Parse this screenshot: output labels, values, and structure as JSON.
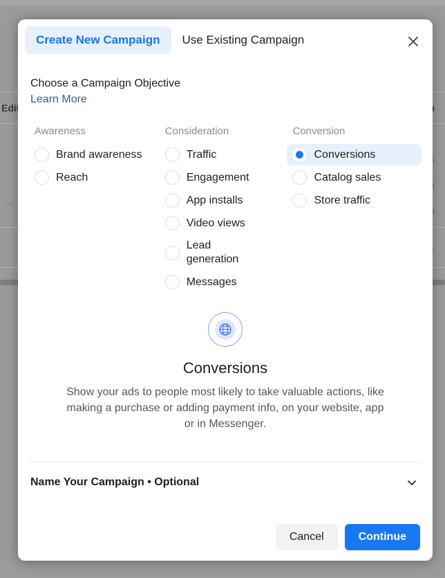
{
  "background": {
    "edit_button_label": "Edit",
    "column_header_fragment": "t p",
    "row_fragments": [
      "r A",
      "r A",
      "r A",
      "er ,"
    ],
    "ellipsis": "…"
  },
  "modal": {
    "tabs": [
      {
        "label": "Create New Campaign",
        "active": true
      },
      {
        "label": "Use Existing Campaign",
        "active": false
      }
    ],
    "close_icon": "close-icon",
    "heading": "Choose a Campaign Objective",
    "learn_more_label": "Learn More",
    "objective_groups": [
      {
        "title": "Awareness",
        "options": [
          {
            "label": "Brand awareness",
            "selected": false
          },
          {
            "label": "Reach",
            "selected": false
          }
        ]
      },
      {
        "title": "Consideration",
        "options": [
          {
            "label": "Traffic",
            "selected": false
          },
          {
            "label": "Engagement",
            "selected": false
          },
          {
            "label": "App installs",
            "selected": false
          },
          {
            "label": "Video views",
            "selected": false
          },
          {
            "label": "Lead generation",
            "selected": false
          },
          {
            "label": "Messages",
            "selected": false
          }
        ]
      },
      {
        "title": "Conversion",
        "options": [
          {
            "label": "Conversions",
            "selected": true
          },
          {
            "label": "Catalog sales",
            "selected": false
          },
          {
            "label": "Store traffic",
            "selected": false
          }
        ]
      }
    ],
    "detail": {
      "icon": "globe-icon",
      "title": "Conversions",
      "description": "Show your ads to people most likely to take valuable actions, like making a purchase or adding payment info, on your website, app or in Messenger."
    },
    "name_section": {
      "label": "Name Your Campaign • Optional",
      "chevron_icon": "chevron-down-icon"
    },
    "footer": {
      "cancel_label": "Cancel",
      "continue_label": "Continue"
    }
  },
  "colors": {
    "accent": "#1877f2",
    "accent_soft": "#e7f0fd",
    "link": "#3b5998",
    "text": "#1c1e21",
    "muted": "#8a8d91",
    "backdrop": "#9b9b9b"
  }
}
